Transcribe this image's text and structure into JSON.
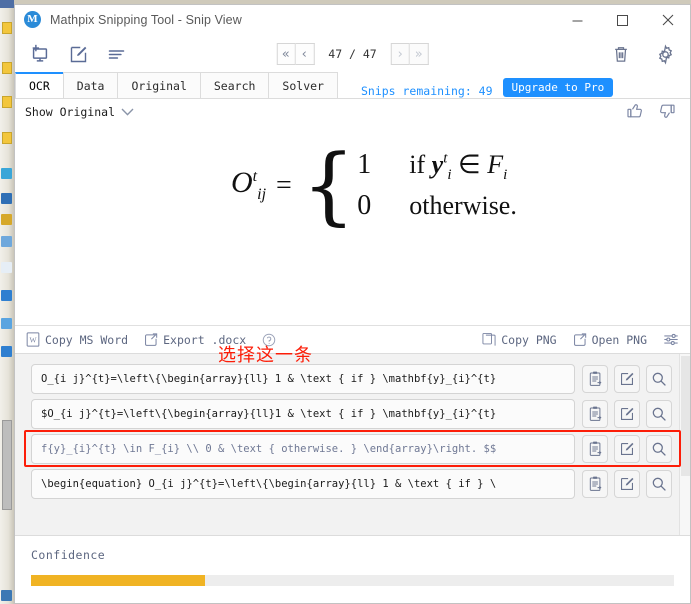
{
  "window": {
    "title": "Mathpix Snipping Tool - Snip View",
    "logo_letter": "M",
    "minimize_label": "—",
    "maximize_label": "□",
    "close_label": "✕"
  },
  "toolbar": {
    "icons": [
      {
        "name": "new-snip-icon",
        "label": "New Snip"
      },
      {
        "name": "edit-snip-icon",
        "label": "Edit Snip"
      },
      {
        "name": "list-view-icon",
        "label": "List View"
      }
    ],
    "right_icons": [
      {
        "name": "trash-icon",
        "label": "Delete"
      },
      {
        "name": "gear-icon",
        "label": "Settings"
      }
    ]
  },
  "pager": {
    "first_label": "«",
    "prev_label": "‹",
    "indicator": "47 / 47",
    "next_label": "›",
    "last_label": "»",
    "current_page": 47,
    "total_pages": 47
  },
  "tabs": [
    {
      "label": "OCR",
      "active": true
    },
    {
      "label": "Data",
      "active": false
    },
    {
      "label": "Original",
      "active": false
    },
    {
      "label": "Search",
      "active": false
    },
    {
      "label": "Solver",
      "active": false
    }
  ],
  "snips": {
    "remaining_text": "Snips remaining: 49",
    "remaining_count": 49,
    "upgrade_label": "Upgrade to Pro",
    "accent_color": "#1e90ff"
  },
  "show_original": {
    "label": "Show Original",
    "chevron": "⌄"
  },
  "feedback": {
    "thumbs_up": "thumbs-up-icon",
    "thumbs_down": "thumbs-down-icon"
  },
  "formula": {
    "lhs_base": "O",
    "lhs_sub": "ij",
    "lhs_sup": "t",
    "equals": "=",
    "brace": "{",
    "case1_value": "1",
    "case1_cond_if": "if",
    "case1_cond_y": "y",
    "case1_cond_y_sub": "i",
    "case1_cond_y_sup": "t",
    "case1_cond_in": "∈",
    "case1_cond_f": "F",
    "case1_cond_f_sub": "i",
    "case2_value": "0",
    "case2_cond": "otherwise."
  },
  "export_bar": {
    "left_items": [
      {
        "icon": "word-doc-icon",
        "label": "Copy MS Word"
      },
      {
        "icon": "export-arrow-icon",
        "label": "Export .docx"
      },
      {
        "icon": "help-circle-icon",
        "label": ""
      }
    ],
    "right_items": [
      {
        "icon": "copy-page-icon",
        "label": "Copy PNG"
      },
      {
        "icon": "open-external-icon",
        "label": "Open PNG"
      },
      {
        "icon": "sliders-icon",
        "label": ""
      }
    ]
  },
  "annotation": {
    "text": "选择这一条",
    "color": "#fc1d08"
  },
  "results": {
    "row_action_icons": [
      {
        "name": "copy-clipboard-icon",
        "label": "Copy"
      },
      {
        "name": "edit-pencil-icon",
        "label": "Edit"
      },
      {
        "name": "search-magnifier-icon",
        "label": "Search"
      }
    ],
    "rows": [
      {
        "text": "O_{i j}^{t}=\\left\\{\\begin{array}{ll} 1 & \\text { if } \\mathbf{y}_{i}^{t}",
        "muted": false,
        "selected": false
      },
      {
        "text": "$O_{i j}^{t}=\\left\\{\\begin{array}{ll}1 & \\text { if } \\mathbf{y}_{i}^{t}",
        "muted": false,
        "selected": false
      },
      {
        "text": "f{y}_{i}^{t} \\in F_{i} \\\\ 0 & \\text { otherwise. } \\end{array}\\right.  $$",
        "muted": true,
        "selected": true
      },
      {
        "text": "\\begin{equation}  O_{i j}^{t}=\\left\\{\\begin{array}{ll} 1 & \\text { if } \\",
        "muted": false,
        "selected": false
      }
    ]
  },
  "confidence": {
    "label": "Confidence",
    "percent": 27,
    "fill_color": "#f0b323",
    "track_color": "#ededed"
  }
}
